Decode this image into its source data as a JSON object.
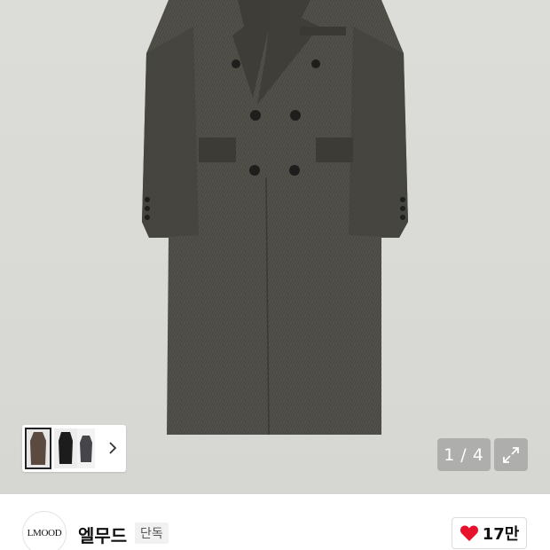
{
  "gallery": {
    "current_page": "1",
    "separator": "/",
    "total_pages": "4",
    "color_count": 3,
    "colors": [
      "#5a4a40",
      "#1c1c1c",
      "#45464a"
    ]
  },
  "brand": {
    "logo_text": "LMOOD",
    "name": "엘무드",
    "badge": "단독",
    "like_count": "17만",
    "like_color": "#e8112d"
  }
}
